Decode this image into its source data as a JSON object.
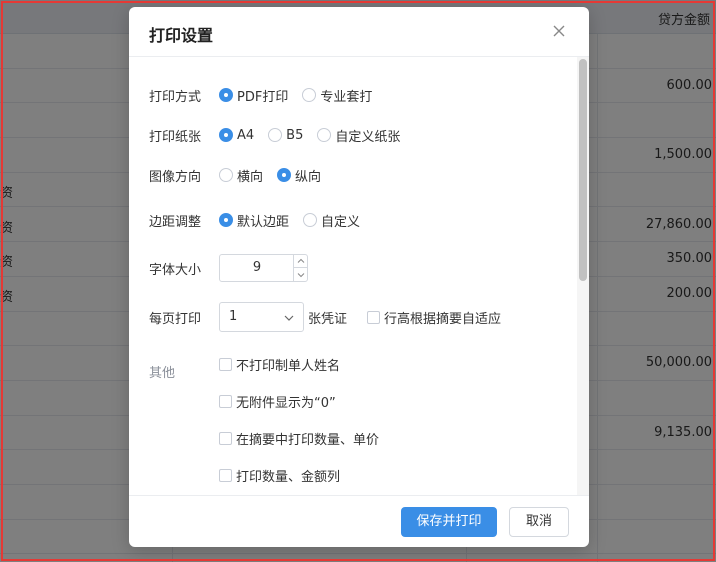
{
  "background": {
    "header_right": "贷方金额",
    "rows": [
      {
        "left": "",
        "right": ""
      },
      {
        "left": "",
        "right": "600.00"
      },
      {
        "left": "",
        "right": ""
      },
      {
        "left": "",
        "right": "1,500.00"
      },
      {
        "left": "资",
        "right": ""
      },
      {
        "left": "资",
        "right": "27,860.00"
      },
      {
        "left": "资",
        "right": "350.00"
      },
      {
        "left": "资",
        "right": "200.00"
      },
      {
        "left": "",
        "right": ""
      },
      {
        "left": "",
        "right": "50,000.00"
      },
      {
        "left": "",
        "right": ""
      },
      {
        "left": "",
        "right": "9,135.00"
      },
      {
        "left": "",
        "right": ""
      },
      {
        "left": "",
        "right": ""
      },
      {
        "left": "",
        "right": ""
      }
    ]
  },
  "dialog": {
    "title": "打印设置",
    "print_mode": {
      "label": "打印方式",
      "options": [
        "PDF打印",
        "专业套打"
      ],
      "selected": "PDF打印"
    },
    "paper": {
      "label": "打印纸张",
      "options": [
        "A4",
        "B5",
        "自定义纸张"
      ],
      "selected": "A4"
    },
    "orientation": {
      "label": "图像方向",
      "options": [
        "横向",
        "纵向"
      ],
      "selected": "纵向"
    },
    "margin": {
      "label": "边距调整",
      "options": [
        "默认边距",
        "自定义"
      ],
      "selected": "默认边距"
    },
    "font_size": {
      "label": "字体大小",
      "value": "9"
    },
    "per_page": {
      "label": "每页打印",
      "value": "1",
      "unit": "张凭证",
      "adaptive_label": "行高根据摘要自适应"
    },
    "other": {
      "label": "其他",
      "options": [
        "不打印制单人姓名",
        "无附件显示为“0”",
        "在摘要中打印数量、单价",
        "打印数量、金额列"
      ]
    },
    "save_print_label": "保存并打印",
    "cancel_label": "取消"
  },
  "colors": {
    "accent": "#3a8ee6",
    "overlay": "rgba(0,0,0,0.5)",
    "frame": "#e53935"
  }
}
